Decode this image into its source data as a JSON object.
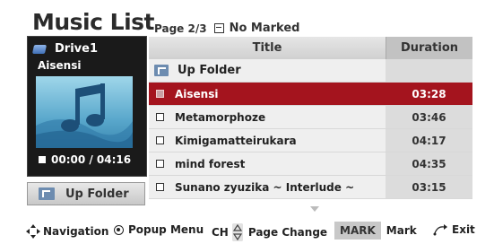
{
  "header": {
    "title": "Music List",
    "page_label": "Page 2/3",
    "marked_label": "No Marked"
  },
  "now_playing": {
    "drive_label": "Drive1",
    "track_name": "Aisensi",
    "time": "00:00 / 04:16"
  },
  "left_up_folder_label": "Up Folder",
  "list": {
    "header_title": "Title",
    "header_duration": "Duration",
    "folder_row": {
      "name": "Up Folder"
    },
    "rows": [
      {
        "name": "Aisensi",
        "duration": "03:28",
        "selected": true
      },
      {
        "name": "Metamorphoze",
        "duration": "03:46",
        "selected": false
      },
      {
        "name": "Kimigamatteirukara",
        "duration": "04:17",
        "selected": false
      },
      {
        "name": "mind forest",
        "duration": "04:35",
        "selected": false
      },
      {
        "name": "Sunano zyuzika ~ Interlude ~",
        "duration": "03:15",
        "selected": false
      }
    ]
  },
  "footer": {
    "navigation": "Navigation",
    "popup_menu": "Popup Menu",
    "ch_label": "CH",
    "page_change": "Page Change",
    "mark_badge": "MARK",
    "mark": "Mark",
    "exit": "Exit"
  },
  "colors": {
    "selected_row": "#a4141e",
    "panel_dark": "#1a1a1a",
    "header_gray": "#d0d0d0"
  }
}
